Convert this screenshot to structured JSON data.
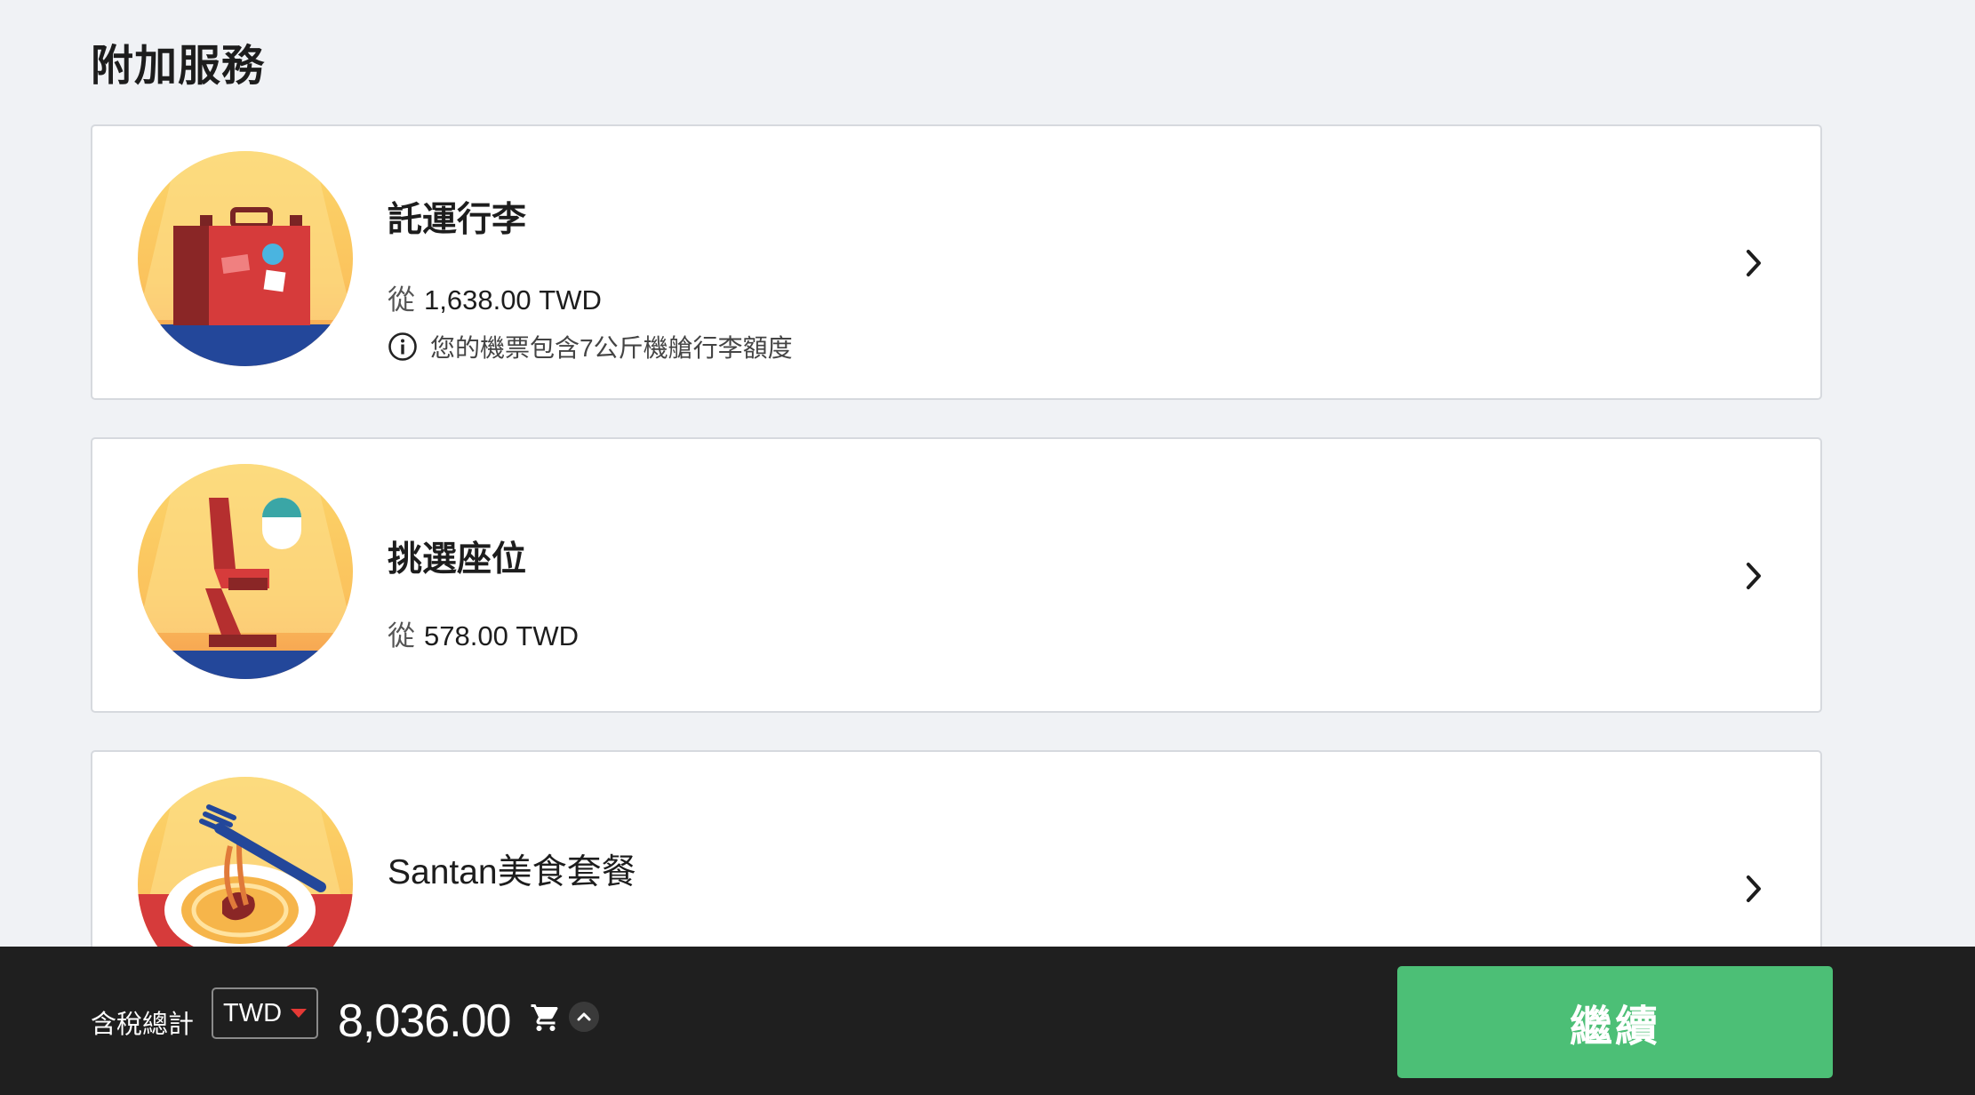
{
  "page": {
    "title": "附加服務"
  },
  "services": [
    {
      "title": "託運行李",
      "from_label": "從",
      "price": "1,638.00 TWD",
      "info": "您的機票包含7公斤機艙行李額度",
      "icon": "checked-baggage-illustration"
    },
    {
      "title": "挑選座位",
      "from_label": "從",
      "price": "578.00 TWD",
      "icon": "seat-selection-illustration"
    },
    {
      "title": "Santan美食套餐",
      "icon": "meal-illustration"
    }
  ],
  "footer": {
    "total_label": "含稅總計",
    "currency": "TWD",
    "total_amount": "8,036.00",
    "continue_label": "繼續"
  },
  "colors": {
    "accent_green": "#4cbf76",
    "footer_bg": "#1f1f1f",
    "page_bg": "#f0f2f5",
    "caret_red": "#e53935"
  }
}
